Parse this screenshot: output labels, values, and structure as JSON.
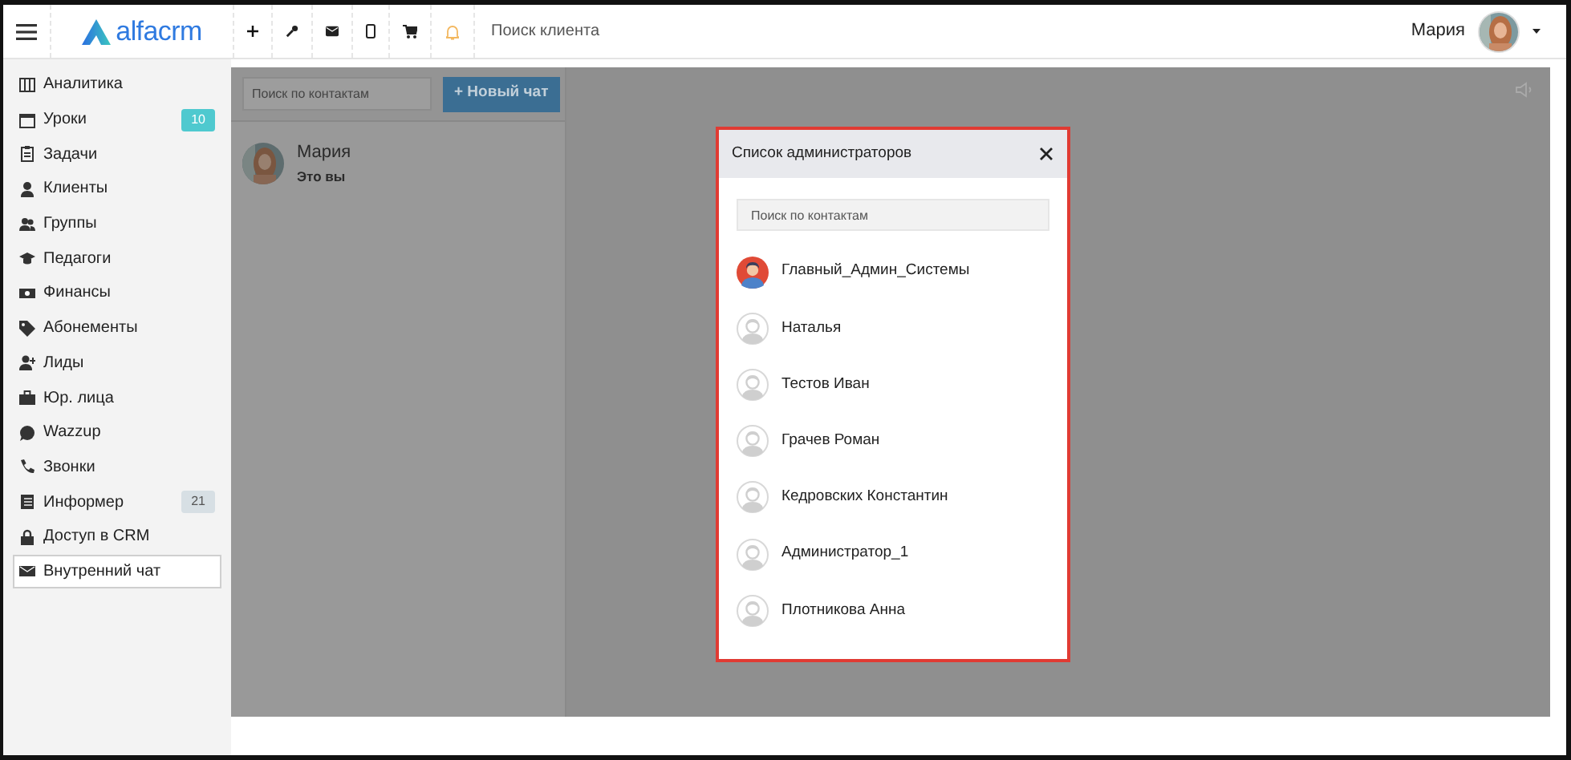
{
  "header": {
    "logo": "alfacrm",
    "search_placeholder": "Поиск клиента",
    "user_name": "Мария"
  },
  "sidebar": {
    "items": [
      {
        "label": "Аналитика",
        "selected": false
      },
      {
        "label": "Уроки",
        "selected": false,
        "badge": "10",
        "color": "#4fc9cf"
      },
      {
        "label": "Задачи",
        "selected": false
      },
      {
        "label": "Клиенты",
        "selected": false
      },
      {
        "label": "Группы",
        "selected": false
      },
      {
        "label": "Педагоги",
        "selected": false
      },
      {
        "label": "Финансы",
        "selected": false
      },
      {
        "label": "Абонементы",
        "selected": false
      },
      {
        "label": "Лиды",
        "selected": false
      },
      {
        "label": "Юр. лица",
        "selected": false
      },
      {
        "label": "Wazzup",
        "selected": false
      },
      {
        "label": "Звонки",
        "selected": false
      },
      {
        "label": "Информер",
        "selected": false,
        "badge": "21",
        "color": "#d7dfe4"
      },
      {
        "label": "Доступ в CRM",
        "selected": false
      },
      {
        "label": "Внутренний чат",
        "selected": true
      }
    ]
  },
  "chat": {
    "search_placeholder": "Поиск по контактам",
    "new_chat_button": "+ Новый чат",
    "contacts": [
      {
        "name": "Мария",
        "subtitle": "Это вы"
      }
    ]
  },
  "modal": {
    "title": "Список администраторов",
    "search_placeholder": "Поиск по контактам",
    "admins": [
      {
        "name": "Главный_Админ_Системы",
        "kind": "custom"
      },
      {
        "name": "Наталья",
        "kind": "default"
      },
      {
        "name": "Тестов Иван",
        "kind": "default"
      },
      {
        "name": "Грачев Роман",
        "kind": "default"
      },
      {
        "name": "Кедровских Константин",
        "kind": "default"
      },
      {
        "name": "Администратор_1",
        "kind": "default"
      },
      {
        "name": "Плотникова Анна",
        "kind": "default"
      }
    ]
  }
}
